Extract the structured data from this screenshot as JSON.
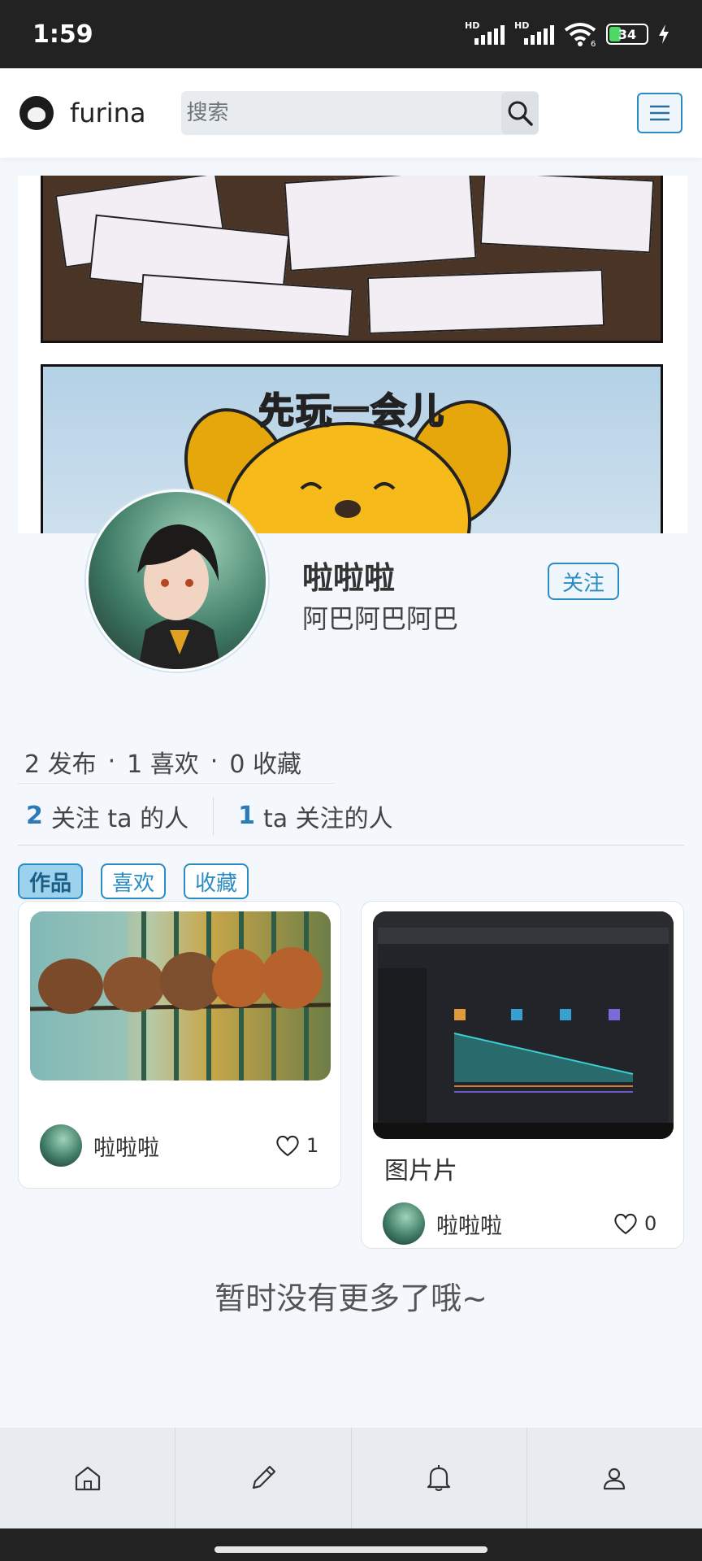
{
  "status_bar": {
    "time": "1:59",
    "battery": "34",
    "network_label_1": "HD",
    "network_label_2": "HD",
    "wifi_label": "6"
  },
  "header": {
    "brand": "furina",
    "search_placeholder": "搜索"
  },
  "banner": {
    "caption": "先玩一会儿"
  },
  "profile": {
    "name": "啦啦啦",
    "bio": "阿巴阿巴阿巴",
    "follow_label": "关注"
  },
  "stats": {
    "posts": "2 发布",
    "likes": "1 喜欢",
    "favorites": "0 收藏",
    "separator": "·",
    "followers_count": "2",
    "followers_label": "关注 ta 的人",
    "following_count": "1",
    "following_label": "ta 关注的人"
  },
  "tabs": [
    {
      "label": "作品"
    },
    {
      "label": "喜欢"
    },
    {
      "label": "收藏"
    }
  ],
  "posts": [
    {
      "title": "",
      "author": "啦啦啦",
      "likes": "1"
    },
    {
      "title": "图片片",
      "author": "啦啦啦",
      "likes": "0"
    }
  ],
  "end_message": "暂时没有更多了哦~",
  "bottom_nav": [
    {
      "icon": "home-icon"
    },
    {
      "icon": "pencil-icon"
    },
    {
      "icon": "bell-icon"
    },
    {
      "icon": "user-icon"
    }
  ]
}
